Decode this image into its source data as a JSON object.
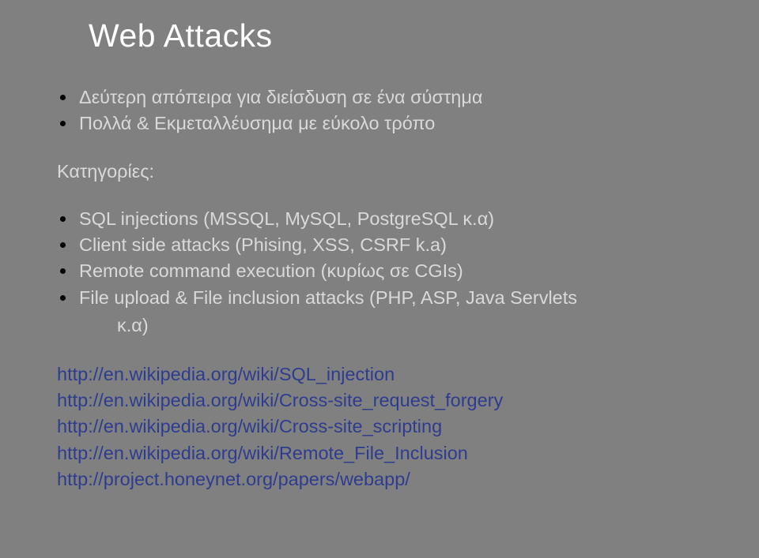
{
  "title": "Web Attacks",
  "intro_bullets": [
    "Δεύτερη απόπειρα για διείσδυση σε ένα σύστημα",
    "Πολλά & Εκμεταλλέυσημα με εύκολο τρόπο"
  ],
  "categories_label": "Κατηγορίες:",
  "category_bullets": [
    "SQL injections (MSSQL, MySQL, PostgreSQL κ.α)",
    "Client side attacks (Phising, XSS, CSRF k.a)",
    "Remote command execution (κυρίως σε CGIs)"
  ],
  "category_wrap_bullet_line1": "File upload & File inclusion attacks (PHP, ASP, Java Servlets",
  "category_wrap_bullet_line2": "κ.α)",
  "links": [
    "http://en.wikipedia.org/wiki/SQL_injection",
    "http://en.wikipedia.org/wiki/Cross-site_request_forgery",
    "http://en.wikipedia.org/wiki/Cross-site_scripting",
    "http://en.wikipedia.org/wiki/Remote_File_Inclusion",
    "http://project.honeynet.org/papers/webapp/"
  ]
}
